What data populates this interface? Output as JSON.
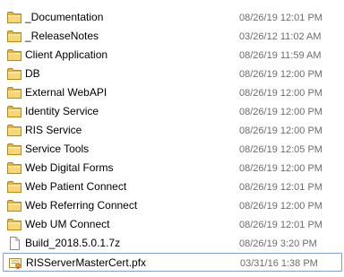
{
  "files": [
    {
      "name": "_Documentation",
      "date": "08/26/19 12:01 PM",
      "icon": "folder-icon"
    },
    {
      "name": "_ReleaseNotes",
      "date": "03/26/12 11:02 AM",
      "icon": "folder-icon"
    },
    {
      "name": "Client Application",
      "date": "08/26/19 11:59 AM",
      "icon": "folder-icon"
    },
    {
      "name": "DB",
      "date": "08/26/19 12:00 PM",
      "icon": "folder-icon"
    },
    {
      "name": "External WebAPI",
      "date": "08/26/19 12:00 PM",
      "icon": "folder-icon"
    },
    {
      "name": "Identity Service",
      "date": "08/26/19 12:00 PM",
      "icon": "folder-icon"
    },
    {
      "name": "RIS Service",
      "date": "08/26/19 12:00 PM",
      "icon": "folder-icon"
    },
    {
      "name": "Service Tools",
      "date": "08/26/19 12:05 PM",
      "icon": "folder-icon"
    },
    {
      "name": "Web Digital Forms",
      "date": "08/26/19 12:00 PM",
      "icon": "folder-icon"
    },
    {
      "name": "Web Patient Connect",
      "date": "08/26/19 12:01 PM",
      "icon": "folder-icon"
    },
    {
      "name": "Web Referring Connect",
      "date": "08/26/19 12:00 PM",
      "icon": "folder-icon"
    },
    {
      "name": "Web UM Connect",
      "date": "08/26/19 12:01 PM",
      "icon": "folder-icon"
    },
    {
      "name": "Build_2018.5.0.1.7z",
      "date": "08/26/19 3:20 PM",
      "icon": "file-icon"
    },
    {
      "name": "RISServerMasterCert.pfx",
      "date": "03/31/16 1:38 PM",
      "icon": "certificate-icon",
      "focused": true
    }
  ],
  "colors": {
    "folder": "#e8c25a",
    "date_text": "#6d6d6d",
    "focus_border": "#7da2ce"
  }
}
